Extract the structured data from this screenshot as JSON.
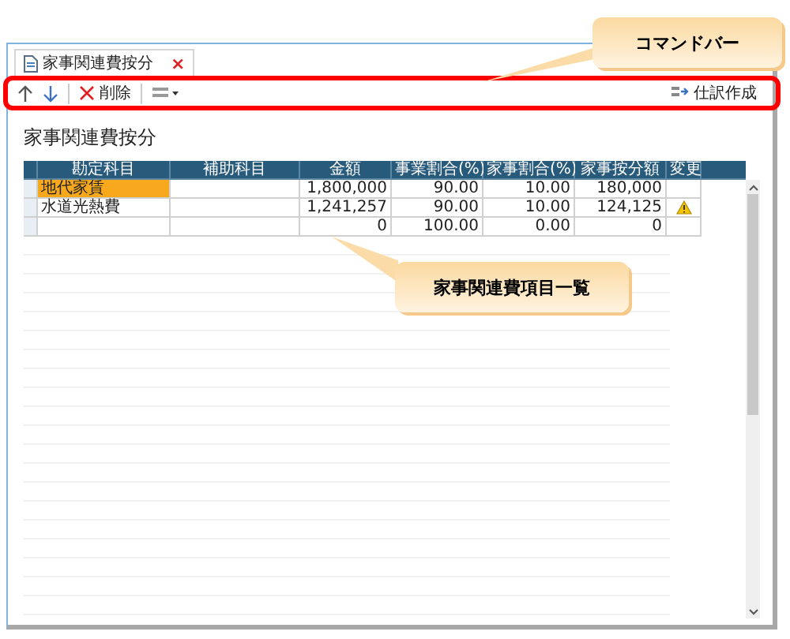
{
  "tab": {
    "label": "家事関連費按分",
    "close": "×"
  },
  "toolbar": {
    "delete_label": "削除",
    "journal_label": "仕訳作成"
  },
  "page_title": "家事関連費按分",
  "table": {
    "columns": [
      "勘定科目",
      "補助科目",
      "金額",
      "事業割合(%)",
      "家事割合(%)",
      "家事按分額",
      "変更"
    ],
    "rows": [
      {
        "account": "地代家賃",
        "amount": "1,800,000",
        "business_ratio": "90.00",
        "household_ratio": "10.00",
        "household_amount": "180,000",
        "selected": true,
        "warning": false
      },
      {
        "account": "水道光熱費",
        "amount": "1,241,257",
        "business_ratio": "90.00",
        "household_ratio": "10.00",
        "household_amount": "124,125",
        "selected": false,
        "warning": true
      }
    ],
    "total_row": {
      "amount": "0",
      "business_ratio": "100.00",
      "household_ratio": "0.00",
      "household_amount": "0"
    }
  },
  "callouts": [
    {
      "text": "コマンドバー"
    },
    {
      "text": "家事関連費項目一覧"
    }
  ]
}
